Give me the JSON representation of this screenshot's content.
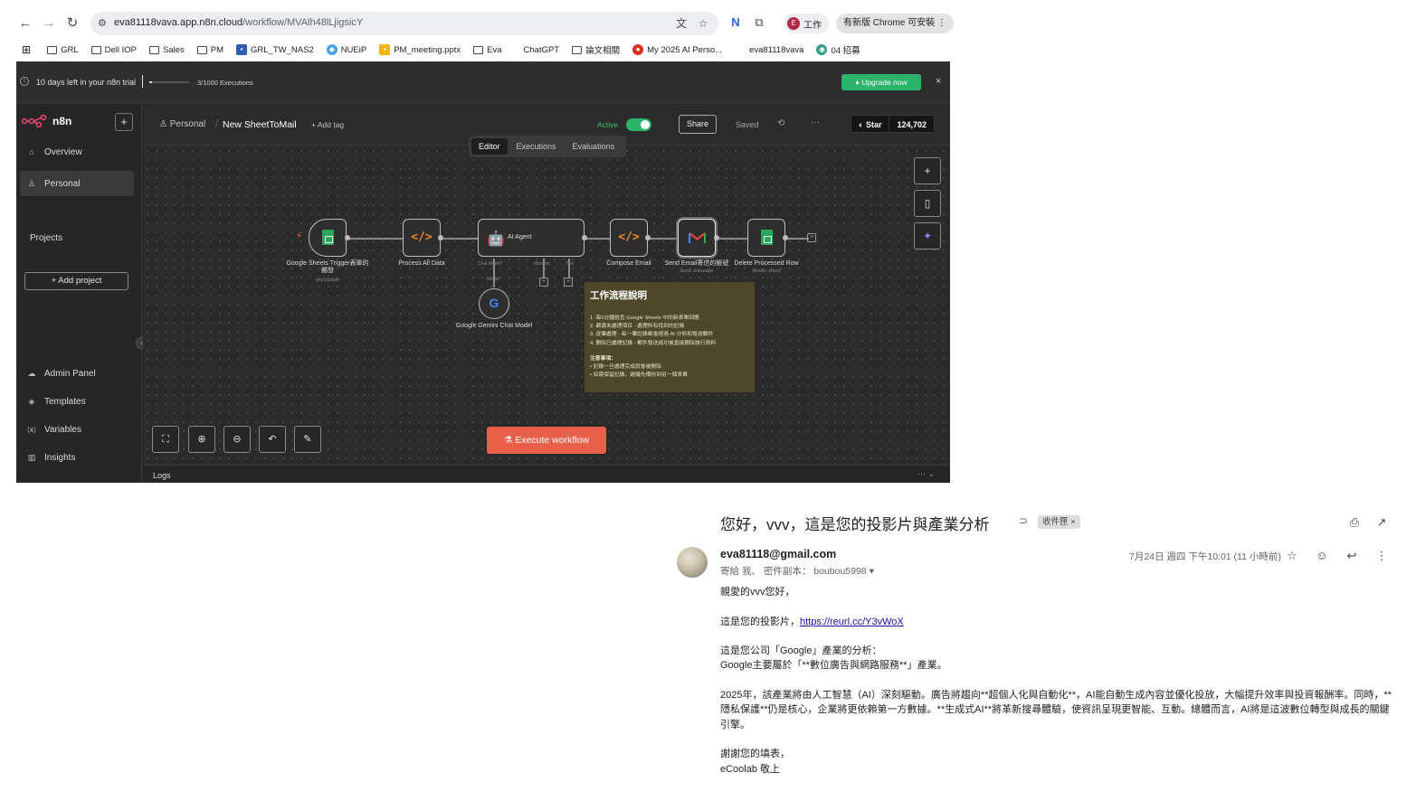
{
  "browser": {
    "url_host": "eva81118vava.app.n8n.cloud",
    "url_path": "/workflow/MVAlh48lLjigsicY",
    "profile_label": "工作",
    "profile_initial": "E",
    "update_label": "有新版 Chrome 可安裝",
    "bookmarks": [
      "GRL",
      "Dell IOP",
      "Sales",
      "PM",
      "GRL_TW_NAS2",
      "NUEiP",
      "PM_meeting.pptx",
      "Eva",
      "ChatGPT",
      "論文相關",
      "My 2025 AI Perso...",
      "eva81118vava",
      "04 招募"
    ]
  },
  "n8n": {
    "trial_text": "10 days left in your n8n trial",
    "executions_text": "3/1000 Executions",
    "executions_fraction": 0.003,
    "upgrade_label": "Upgrade now",
    "brand": "n8n",
    "sidebar": {
      "overview": "Overview",
      "personal": "Personal",
      "projects_heading": "Projects",
      "add_project": "Add project",
      "admin_panel": "Admin Panel",
      "templates": "Templates",
      "variables": "Variables",
      "insights": "Insights"
    },
    "header": {
      "breadcrumb": "Personal",
      "workflow_name": "New SheetToMail",
      "add_tag": "+ Add tag",
      "active_label": "Active",
      "share_label": "Share",
      "saved_label": "Saved",
      "github_star": "Star",
      "github_count": "124,702"
    },
    "tabs": [
      "Editor",
      "Executions",
      "Evaluations"
    ],
    "nodes": {
      "trigger": {
        "label": "Google Sheets Trigger表單的觸發",
        "sub": "anyUpdate"
      },
      "process": {
        "label": "Process All Data"
      },
      "agent": {
        "label": "AI Agent",
        "port_model": "Chat Model*",
        "port_memory": "Memory",
        "port_tool": "Tool"
      },
      "gemini": {
        "label": "Google Gemini Chat Model",
        "edge_label": "Model"
      },
      "compose": {
        "label": "Compose Email"
      },
      "send": {
        "label": "Send Email寄信的帳號",
        "sub": "send: message"
      },
      "delete": {
        "label": "Delete Processed Row",
        "sub": "delete: sheet"
      }
    },
    "sticky": {
      "title": "工作流程說明",
      "steps": [
        "1. 每5分鐘檢查 Google Sheets 中的新表單回應",
        "2. 篩選未處理項目 - 處理所有找到的記錄",
        "3. 逐筆處理 - 每一筆記錄都會經過 AI 分析和發送郵件",
        "4. 刪除已處理記錄 - 郵件發送成功後直接刪除該行資料"
      ],
      "note_title": "注意事項：",
      "notes": [
        "• 記錄一旦處理完成就會被刪除",
        "• 如需保留記錄，建議先備份到另一個表單"
      ]
    },
    "execute_label": "Execute workflow",
    "logs_label": "Logs"
  },
  "mail": {
    "subject": "您好，vvv，這是您的投影片與產業分析",
    "label": "收件匣",
    "from": "eva81118@gmail.com",
    "to": "寄給 我、 密件副本： boubou5998",
    "time": "7月24日 週四 下午10:01 (11 小時前)",
    "greeting": "親愛的vvv您好，",
    "slides_prefix": "這是您的投影片，",
    "slides_link": "https://reurl.cc/Y3vWoX",
    "analysis_line1": "這是您公司「Google」產業的分析：",
    "analysis_line2": "Google主要屬於「**數位廣告與網路服務**」產業。",
    "paragraph": "2025年，該產業將由人工智慧（AI）深刻驅動。廣告將趨向**超個人化與自動化**，AI能自動生成內容並優化投放，大幅提升效率與投資報酬率。同時，**隱私保護**仍是核心，企業將更依賴第一方數據。**生成式AI**將革新搜尋體驗，使資訊呈現更智能、互動。總體而言，AI將是這波數位轉型與成長的關鍵引擎。",
    "thanks": "謝謝您的填表，",
    "signature": "eCoolab 敬上"
  },
  "colors": {
    "n8n_bg": "#2b2b2b",
    "active_green": "#2bb36b",
    "execute_button": "#e8604a",
    "sticky_bg": "#4f4729",
    "link": "#1a0dab"
  }
}
